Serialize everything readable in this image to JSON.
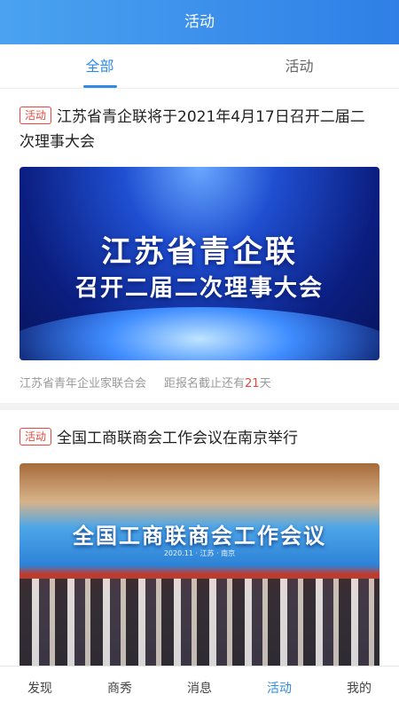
{
  "header": {
    "title": "活动"
  },
  "tabs": [
    {
      "label": "全部",
      "active": true
    },
    {
      "label": "活动",
      "active": false
    }
  ],
  "feed": [
    {
      "tag": "活动",
      "title": "江苏省青企联将于2021年4月17日召开二届二次理事大会",
      "banner_line1": "江苏省青企联",
      "banner_line2": "召开二届二次理事大会",
      "org": "江苏省青年企业家联合会",
      "deadline_prefix": "距报名截止还有",
      "deadline_days": "21",
      "deadline_suffix": "天"
    },
    {
      "tag": "活动",
      "title": "全国工商联商会工作会议在南京举行",
      "banner_line1": "全国工商联商会工作会议",
      "banner_sub": "2020.11 · 江苏 · 南京"
    }
  ],
  "tabbar": [
    {
      "label": "发现"
    },
    {
      "label": "商秀"
    },
    {
      "label": "消息"
    },
    {
      "label": "活动",
      "active": true
    },
    {
      "label": "我的"
    }
  ],
  "colors": {
    "accent": "#2f8be6",
    "tag": "#e24a3b"
  }
}
